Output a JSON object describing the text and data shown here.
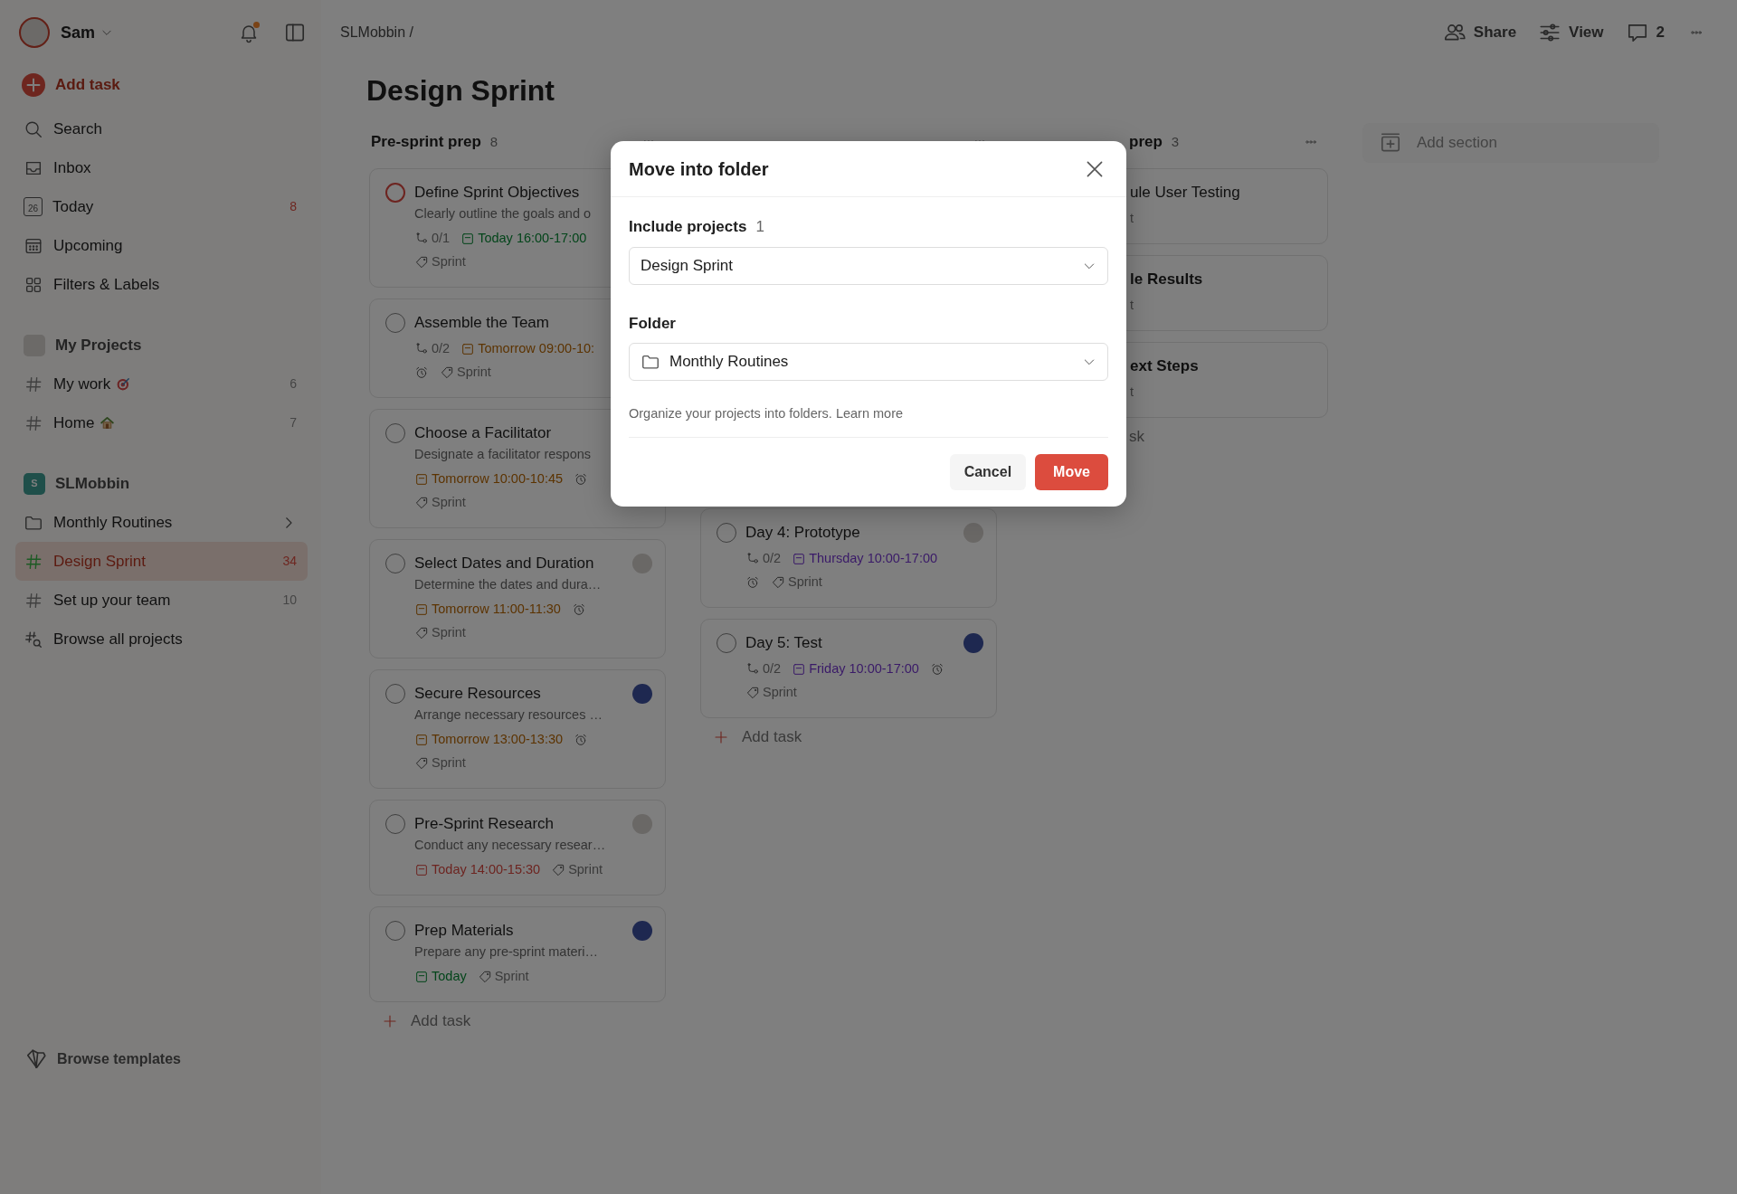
{
  "sidebar": {
    "user": {
      "name": "Sam"
    },
    "notifications": {
      "unread": true
    },
    "add_task": "Add task",
    "nav": [
      {
        "kind": "search",
        "label": "Search"
      },
      {
        "kind": "inbox",
        "label": "Inbox"
      },
      {
        "kind": "today",
        "label": "Today",
        "icon_text": "26",
        "count": "8"
      },
      {
        "kind": "upcoming",
        "label": "Upcoming"
      },
      {
        "kind": "filters",
        "label": "Filters & Labels"
      }
    ],
    "my_projects": {
      "title": "My Projects",
      "projects": [
        {
          "label": "My work",
          "count": "6",
          "kind": "target",
          "color": "#404040",
          "selected": false
        },
        {
          "label": "Home",
          "count": "7",
          "kind": "house",
          "color": "#404040",
          "selected": false
        }
      ]
    },
    "workspace": {
      "name": "SLMobbin",
      "initial": "S",
      "items": [
        {
          "kind": "folder",
          "label": "Monthly Routines",
          "selected": false
        },
        {
          "kind": "project",
          "label": "Design Sprint",
          "count": "34",
          "color": "#1d5a24",
          "selected": true
        },
        {
          "kind": "project",
          "label": "Set up your team",
          "count": "10",
          "color": "#404040",
          "selected": false
        },
        {
          "kind": "browse",
          "label": "Browse all projects",
          "selected": false
        }
      ]
    },
    "templates": "Browse templates"
  },
  "header": {
    "breadcrumb": "SLMobbin /",
    "actions": [
      {
        "kind": "share",
        "label": "Share"
      },
      {
        "kind": "view",
        "label": "View"
      },
      {
        "kind": "comments",
        "label": "2"
      },
      {
        "kind": "more"
      }
    ]
  },
  "board": {
    "title": "Design Sprint",
    "add_section": "Add section",
    "columns": [
      {
        "title": "Pre-sprint prep",
        "count": "8",
        "add_task": "Add task",
        "cards": [
          {
            "title": "Define Sprint Objectives",
            "description": "Clearly outline the goals and o",
            "checkbox": {
              "checked": false,
              "color": "#6d2420"
            },
            "meta_rows": [
              [
                {
                  "kind": "subtasks",
                  "text": "0/1"
                },
                {
                  "kind": "date",
                  "text": "Today 16:00-17:00",
                  "color": "#03451a"
                }
              ],
              [
                {
                  "kind": "label",
                  "text": "Sprint"
                }
              ]
            ]
          },
          {
            "title": "Assemble the Team",
            "checkbox": {
              "checked": false,
              "color": "#404040"
            },
            "meta_rows": [
              [
                {
                  "kind": "subtasks",
                  "text": "0/2"
                },
                {
                  "kind": "date",
                  "text": "Tomorrow 09:00-10:",
                  "color": "#5c3300"
                }
              ],
              [
                {
                  "kind": "reminder"
                },
                {
                  "kind": "label",
                  "text": "Sprint"
                }
              ]
            ]
          },
          {
            "title": "Choose a Facilitator",
            "description": "Designate a facilitator respons",
            "checkbox": {
              "checked": false,
              "color": "#404040"
            },
            "meta_rows": [
              [
                {
                  "kind": "date",
                  "text": "Tomorrow 10:00-10:45",
                  "color": "#5c3300"
                },
                {
                  "kind": "reminder"
                }
              ],
              [
                {
                  "kind": "label",
                  "text": "Sprint"
                }
              ]
            ]
          },
          {
            "title": "Select Dates and Duration",
            "description": "Determine the dates and dura…",
            "checkbox": {
              "checked": false,
              "color": "#404040"
            },
            "avatar": {
              "color": "#6a6866"
            },
            "meta_rows": [
              [
                {
                  "kind": "date",
                  "text": "Tomorrow 11:00-11:30",
                  "color": "#5c3300"
                },
                {
                  "kind": "reminder"
                }
              ],
              [
                {
                  "kind": "label",
                  "text": "Sprint"
                }
              ]
            ]
          },
          {
            "title": "Secure Resources",
            "description": "Arrange necessary resources …",
            "checkbox": {
              "checked": false,
              "color": "#404040"
            },
            "avatar": {
              "color": "#1e2850"
            },
            "meta_rows": [
              [
                {
                  "kind": "date",
                  "text": "Tomorrow 13:00-13:30",
                  "color": "#5c3300"
                },
                {
                  "kind": "reminder"
                }
              ],
              [
                {
                  "kind": "label",
                  "text": "Sprint"
                }
              ]
            ]
          },
          {
            "title": "Pre-Sprint Research",
            "description": "Conduct any necessary resear…",
            "checkbox": {
              "checked": false,
              "color": "#404040"
            },
            "avatar": {
              "color": "#6a6866"
            },
            "meta_rows": [
              [
                {
                  "kind": "date",
                  "text": "Today 14:00-15:30",
                  "color": "#6d2420"
                },
                {
                  "kind": "label",
                  "text": "Sprint"
                }
              ]
            ]
          },
          {
            "title": "Prep Materials",
            "description": "Prepare any pre-sprint materi…",
            "checkbox": {
              "checked": false,
              "color": "#404040"
            },
            "avatar": {
              "color": "#1e2850"
            },
            "meta_rows": [
              [
                {
                  "kind": "date",
                  "text": "Today",
                  "color": "#03451a"
                },
                {
                  "kind": "label",
                  "text": "Sprint"
                }
              ]
            ]
          }
        ]
      },
      {
        "add_task": "Add task",
        "cards": [
          {
            "title": "Day 4: Prototype",
            "checkbox": {
              "checked": false,
              "color": "#404040"
            },
            "avatar": {
              "color": "#6a6866"
            },
            "meta_rows": [
              [
                {
                  "kind": "subtasks",
                  "text": "0/2"
                },
                {
                  "kind": "date",
                  "text": "Thursday 10:00-17:00",
                  "color": "#3a1a68"
                }
              ],
              [
                {
                  "kind": "reminder"
                },
                {
                  "kind": "label",
                  "text": "Sprint"
                }
              ]
            ]
          },
          {
            "title": "Day 5: Test",
            "checkbox": {
              "checked": false,
              "color": "#404040"
            },
            "avatar": {
              "color": "#1e2850"
            },
            "meta_rows": [
              [
                {
                  "kind": "subtasks",
                  "text": "0/2"
                },
                {
                  "kind": "date",
                  "text": "Friday 10:00-17:00",
                  "color": "#3a1a68"
                },
                {
                  "kind": "reminder"
                }
              ],
              [
                {
                  "kind": "label",
                  "text": "Sprint"
                }
              ]
            ]
          }
        ]
      },
      {
        "title": "prep",
        "count": "3",
        "add_task": "sk",
        "cards": [
          {
            "title": "ule User Testing",
            "bold": false,
            "meta_rows": [
              [
                {
                  "kind": "fragment",
                  "text": "t"
                }
              ]
            ]
          },
          {
            "title": "le Results",
            "bold": true,
            "meta_rows": [
              [
                {
                  "kind": "fragment",
                  "text": "t"
                }
              ]
            ]
          },
          {
            "title": "ext Steps",
            "bold": true,
            "meta_rows": [
              [
                {
                  "kind": "fragment",
                  "text": "t"
                }
              ]
            ]
          }
        ]
      }
    ]
  },
  "modal": {
    "title": "Move into folder",
    "projects_label": "Include projects",
    "projects_count": "1",
    "projects_value": "Design Sprint",
    "folder_label": "Folder",
    "folder_value": "Monthly Routines",
    "hint": "Organize your projects into folders.",
    "link": "Learn more",
    "buttons": [
      {
        "kind": "secondary",
        "label": "Cancel"
      },
      {
        "kind": "primary",
        "label": "Move"
      }
    ]
  }
}
